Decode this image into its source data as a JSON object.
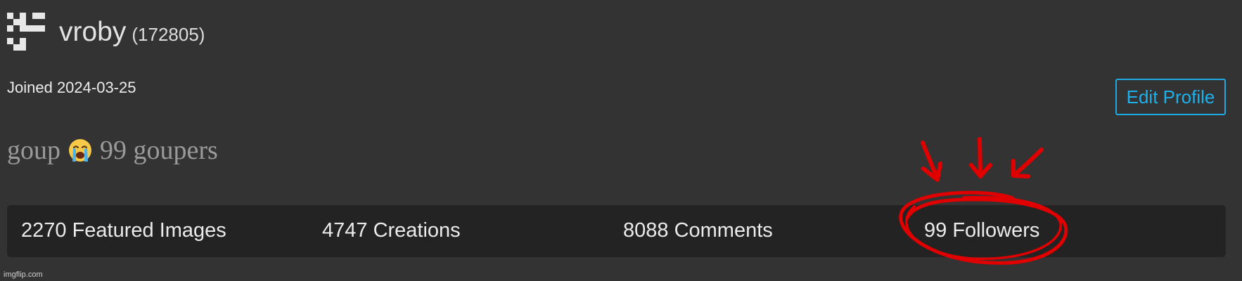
{
  "profile": {
    "username": "vroby",
    "user_id": "(172805)",
    "joined": "Joined 2024-03-25",
    "bio_before": "goup",
    "bio_after": "99 goupers",
    "edit_button": "Edit Profile"
  },
  "stats": [
    {
      "label": "2270 Featured Images"
    },
    {
      "label": "4747 Creations"
    },
    {
      "label": "8088 Comments"
    },
    {
      "label": "99 Followers"
    }
  ],
  "watermark": "imgflip.com",
  "colors": {
    "background": "#333333",
    "stats_bar": "#232323",
    "accent_button": "#1eb0ea",
    "annotation_red": "#e00000"
  },
  "icons": {
    "avatar": "identicon-avatar",
    "bio_emoji": "loudly-crying-face-icon"
  }
}
